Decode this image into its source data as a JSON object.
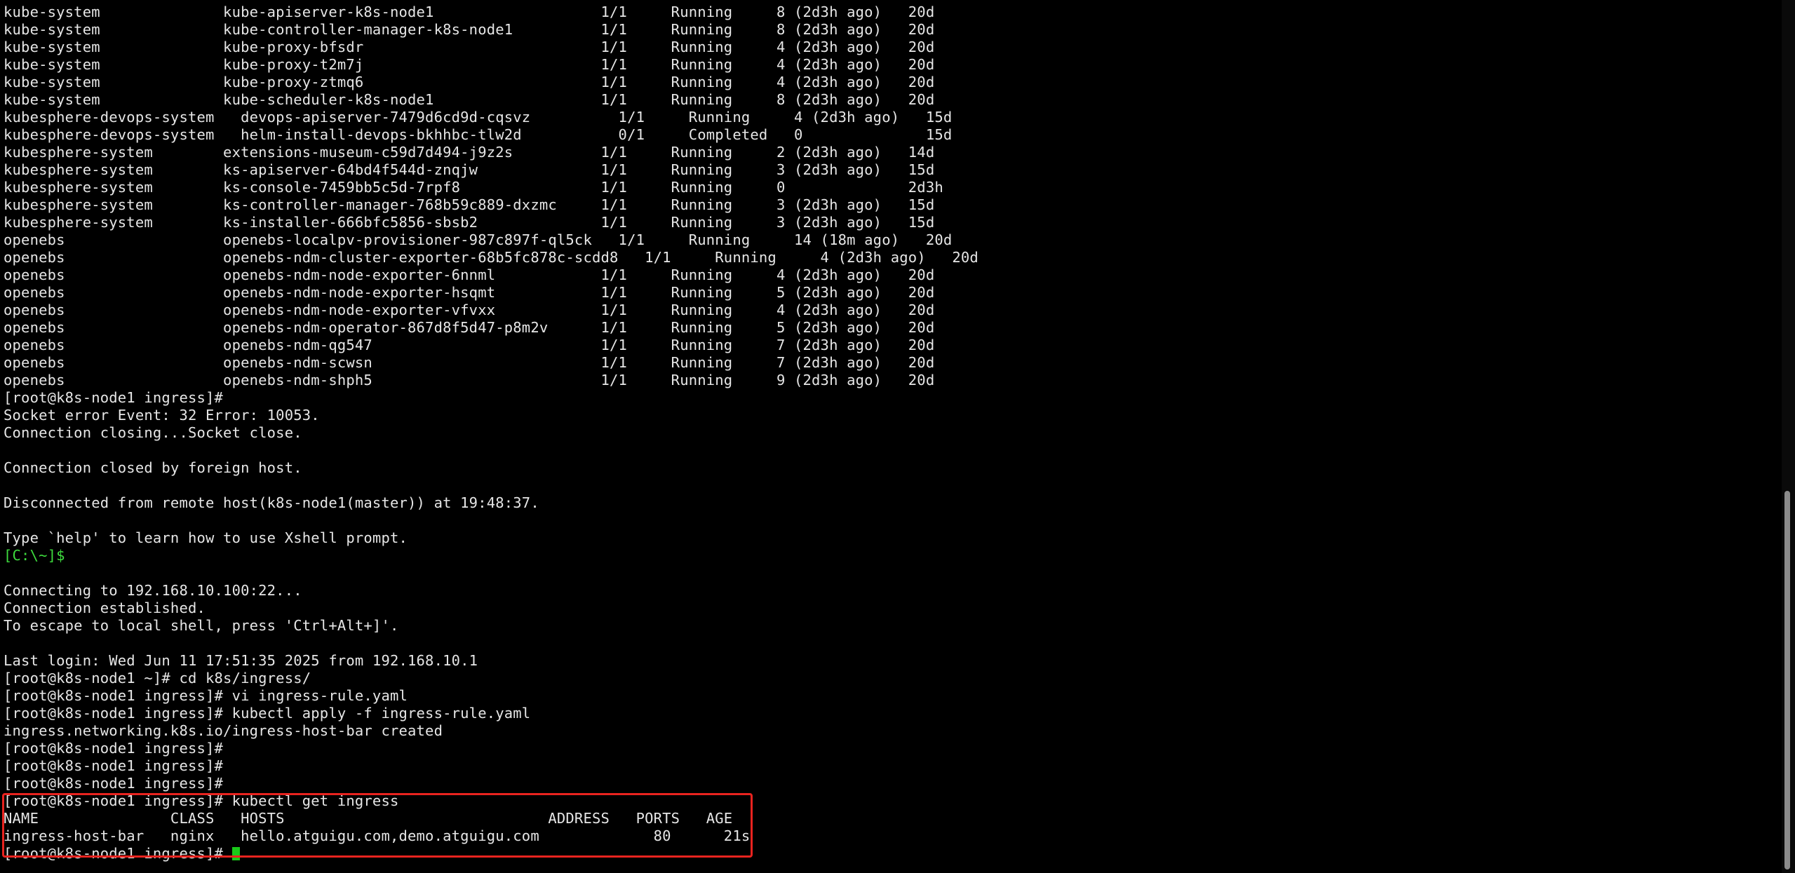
{
  "terminal": {
    "lines": [
      {
        "text": "kube-system              kube-apiserver-k8s-node1                   1/1     Running     8 (2d3h ago)   20d",
        "style": "normal"
      },
      {
        "text": "kube-system              kube-controller-manager-k8s-node1          1/1     Running     8 (2d3h ago)   20d",
        "style": "normal"
      },
      {
        "text": "kube-system              kube-proxy-bfsdr                           1/1     Running     4 (2d3h ago)   20d",
        "style": "normal"
      },
      {
        "text": "kube-system              kube-proxy-t2m7j                           1/1     Running     4 (2d3h ago)   20d",
        "style": "normal"
      },
      {
        "text": "kube-system              kube-proxy-ztmq6                           1/1     Running     4 (2d3h ago)   20d",
        "style": "normal"
      },
      {
        "text": "kube-system              kube-scheduler-k8s-node1                   1/1     Running     8 (2d3h ago)   20d",
        "style": "normal"
      },
      {
        "text": "kubesphere-devops-system   devops-apiserver-7479d6cd9d-cqsvz          1/1     Running     4 (2d3h ago)   15d",
        "style": "normal"
      },
      {
        "text": "kubesphere-devops-system   helm-install-devops-bkhhbc-tlw2d           0/1     Completed   0              15d",
        "style": "normal"
      },
      {
        "text": "kubesphere-system        extensions-museum-c59d7d494-j9z2s          1/1     Running     2 (2d3h ago)   14d",
        "style": "normal"
      },
      {
        "text": "kubesphere-system        ks-apiserver-64bd4f544d-znqjw              1/1     Running     3 (2d3h ago)   15d",
        "style": "normal"
      },
      {
        "text": "kubesphere-system        ks-console-7459bb5c5d-7rpf8                1/1     Running     0              2d3h",
        "style": "normal"
      },
      {
        "text": "kubesphere-system        ks-controller-manager-768b59c889-dxzmc     1/1     Running     3 (2d3h ago)   15d",
        "style": "normal"
      },
      {
        "text": "kubesphere-system        ks-installer-666bfc5856-sbsb2              1/1     Running     3 (2d3h ago)   15d",
        "style": "normal"
      },
      {
        "text": "openebs                  openebs-localpv-provisioner-987c897f-ql5ck   1/1     Running     14 (18m ago)   20d",
        "style": "normal"
      },
      {
        "text": "openebs                  openebs-ndm-cluster-exporter-68b5fc878c-scdd8   1/1     Running     4 (2d3h ago)   20d",
        "style": "normal"
      },
      {
        "text": "openebs                  openebs-ndm-node-exporter-6nnml            1/1     Running     4 (2d3h ago)   20d",
        "style": "normal"
      },
      {
        "text": "openebs                  openebs-ndm-node-exporter-hsqmt            1/1     Running     5 (2d3h ago)   20d",
        "style": "normal"
      },
      {
        "text": "openebs                  openebs-ndm-node-exporter-vfvxx            1/1     Running     4 (2d3h ago)   20d",
        "style": "normal"
      },
      {
        "text": "openebs                  openebs-ndm-operator-867d8f5d47-p8m2v      1/1     Running     5 (2d3h ago)   20d",
        "style": "normal"
      },
      {
        "text": "openebs                  openebs-ndm-qg547                          1/1     Running     7 (2d3h ago)   20d",
        "style": "normal"
      },
      {
        "text": "openebs                  openebs-ndm-scwsn                          1/1     Running     7 (2d3h ago)   20d",
        "style": "normal"
      },
      {
        "text": "openebs                  openebs-ndm-shph5                          1/1     Running     9 (2d3h ago)   20d",
        "style": "normal"
      },
      {
        "text": "[root@k8s-node1 ingress]#",
        "style": "normal"
      },
      {
        "text": "Socket error Event: 32 Error: 10053.",
        "style": "normal"
      },
      {
        "text": "Connection closing...Socket close.",
        "style": "normal"
      },
      {
        "text": "",
        "style": "normal"
      },
      {
        "text": "Connection closed by foreign host.",
        "style": "normal"
      },
      {
        "text": "",
        "style": "normal"
      },
      {
        "text": "Disconnected from remote host(k8s-node1(master)) at 19:48:37.",
        "style": "normal"
      },
      {
        "text": "",
        "style": "normal"
      },
      {
        "text": "Type `help' to learn how to use Xshell prompt.",
        "style": "normal"
      },
      {
        "text": "[C:\\~]$",
        "style": "green"
      },
      {
        "text": "",
        "style": "normal"
      },
      {
        "text": "Connecting to 192.168.10.100:22...",
        "style": "normal"
      },
      {
        "text": "Connection established.",
        "style": "normal"
      },
      {
        "text": "To escape to local shell, press 'Ctrl+Alt+]'.",
        "style": "normal"
      },
      {
        "text": "",
        "style": "normal"
      },
      {
        "text": "Last login: Wed Jun 11 17:51:35 2025 from 192.168.10.1",
        "style": "normal"
      },
      {
        "text": "[root@k8s-node1 ~]# cd k8s/ingress/",
        "style": "normal"
      },
      {
        "text": "[root@k8s-node1 ingress]# vi ingress-rule.yaml",
        "style": "normal"
      },
      {
        "text": "[root@k8s-node1 ingress]# kubectl apply -f ingress-rule.yaml",
        "style": "normal"
      },
      {
        "text": "ingress.networking.k8s.io/ingress-host-bar created",
        "style": "normal"
      },
      {
        "text": "[root@k8s-node1 ingress]#",
        "style": "normal"
      },
      {
        "text": "[root@k8s-node1 ingress]#",
        "style": "normal"
      },
      {
        "text": "[root@k8s-node1 ingress]#",
        "style": "normal"
      },
      {
        "text": "[root@k8s-node1 ingress]# kubectl get ingress",
        "style": "normal"
      },
      {
        "text": "NAME               CLASS   HOSTS                              ADDRESS   PORTS   AGE",
        "style": "normal"
      },
      {
        "text": "ingress-host-bar   nginx   hello.atguigu.com,demo.atguigu.com             80      21s",
        "style": "normal"
      },
      {
        "text": "[root@k8s-node1 ingress]# ",
        "style": "cursor"
      }
    ]
  },
  "colors": {
    "background": "#000000",
    "text": "#e6e6e6",
    "local_prompt": "#3edc3e",
    "cursor": "#19c919",
    "highlight_border": "#e8231f"
  }
}
